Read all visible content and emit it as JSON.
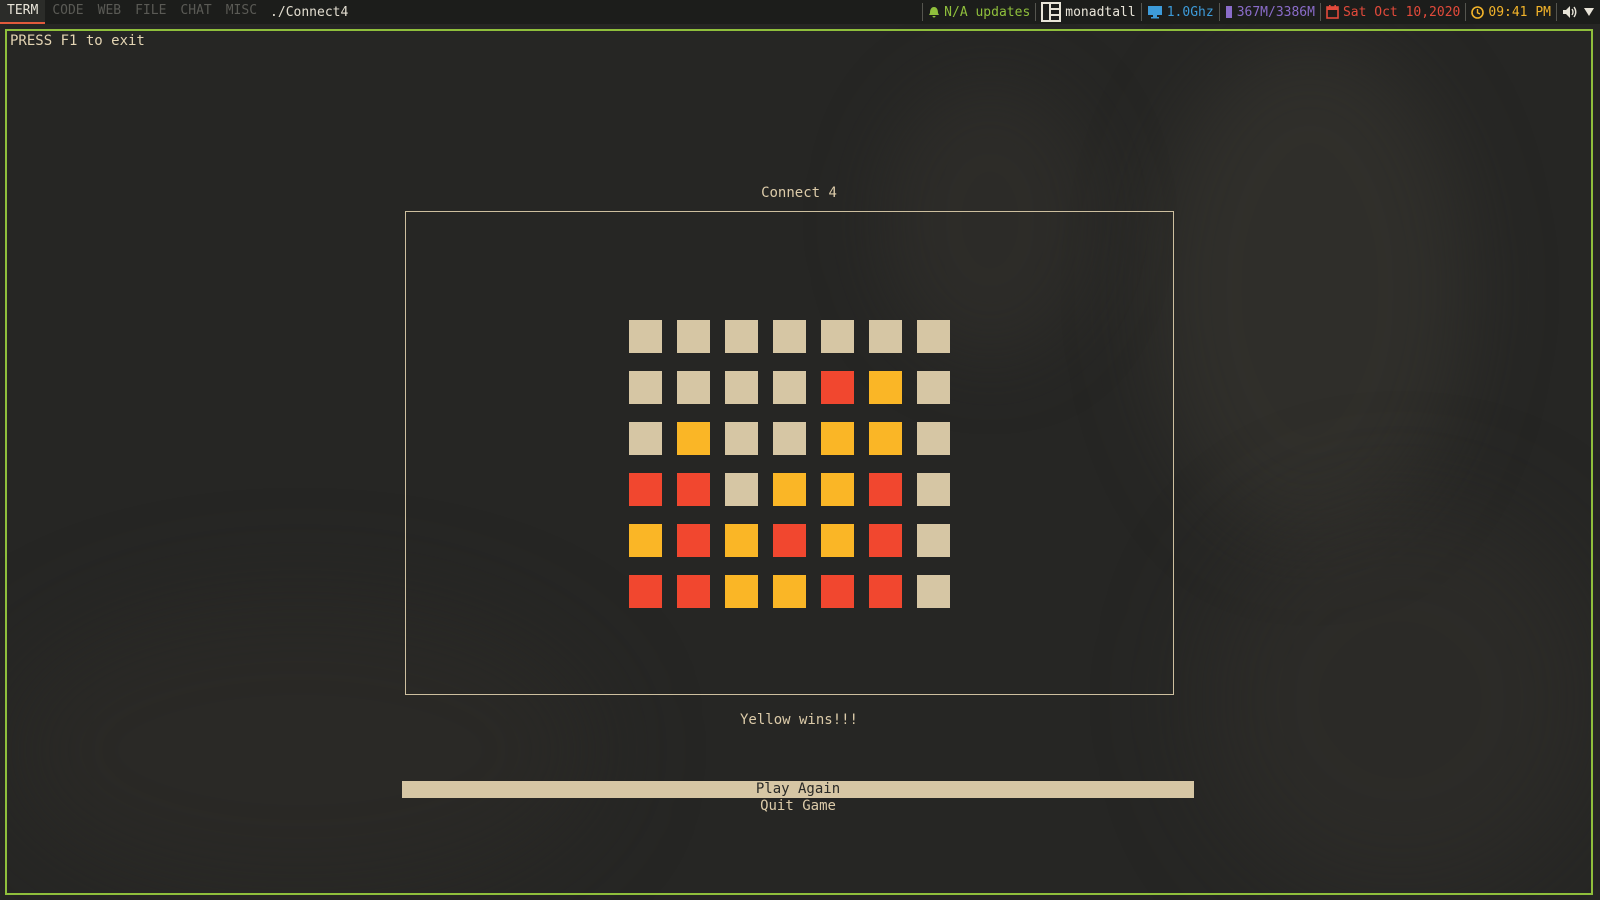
{
  "topbar": {
    "groups": [
      {
        "label": "TERM",
        "active": true
      },
      {
        "label": "CODE",
        "active": false
      },
      {
        "label": "WEB",
        "active": false
      },
      {
        "label": "FILE",
        "active": false
      },
      {
        "label": "CHAT",
        "active": false
      },
      {
        "label": "MISC",
        "active": false
      }
    ],
    "window_title": "./Connect4",
    "updates": {
      "text": "N/A updates",
      "color": "#8fbf3c",
      "icon": "bell-icon"
    },
    "layout": {
      "text": "monadtall",
      "color": "#e8e4d8",
      "icon": "layout-icon"
    },
    "cpu": {
      "text": "1.0Ghz",
      "color": "#3d9bd9",
      "icon": "monitor-icon"
    },
    "memory": {
      "text": "367M/3386M",
      "color": "#8a6cc9",
      "icon": "memory-icon"
    },
    "date": {
      "text": "Sat Oct 10,2020",
      "color": "#e24a3b",
      "icon": "calendar-icon"
    },
    "time": {
      "text": "09:41 PM",
      "color": "#f2b32a",
      "icon": "clock-icon"
    },
    "volume_icon": "speaker-icon",
    "menu_icon": "triangle-down-icon"
  },
  "terminal": {
    "exit_hint": "PRESS F1 to exit",
    "game_title": "Connect 4",
    "status": "Yellow wins!!!",
    "menu": [
      {
        "label": "Play Again",
        "selected": true
      },
      {
        "label": "Quit Game",
        "selected": false
      }
    ]
  },
  "colors": {
    "empty": "#d6c6a4",
    "red": "#f1472f",
    "yellow": "#fab626",
    "accent_green": "#8fbf3c"
  },
  "board": [
    [
      "E",
      "E",
      "E",
      "E",
      "E",
      "E",
      "E"
    ],
    [
      "E",
      "E",
      "E",
      "E",
      "R",
      "Y",
      "E"
    ],
    [
      "E",
      "Y",
      "E",
      "E",
      "Y",
      "Y",
      "E"
    ],
    [
      "R",
      "R",
      "E",
      "Y",
      "Y",
      "R",
      "E"
    ],
    [
      "Y",
      "R",
      "Y",
      "R",
      "Y",
      "R",
      "E"
    ],
    [
      "R",
      "R",
      "Y",
      "Y",
      "R",
      "R",
      "E"
    ]
  ]
}
